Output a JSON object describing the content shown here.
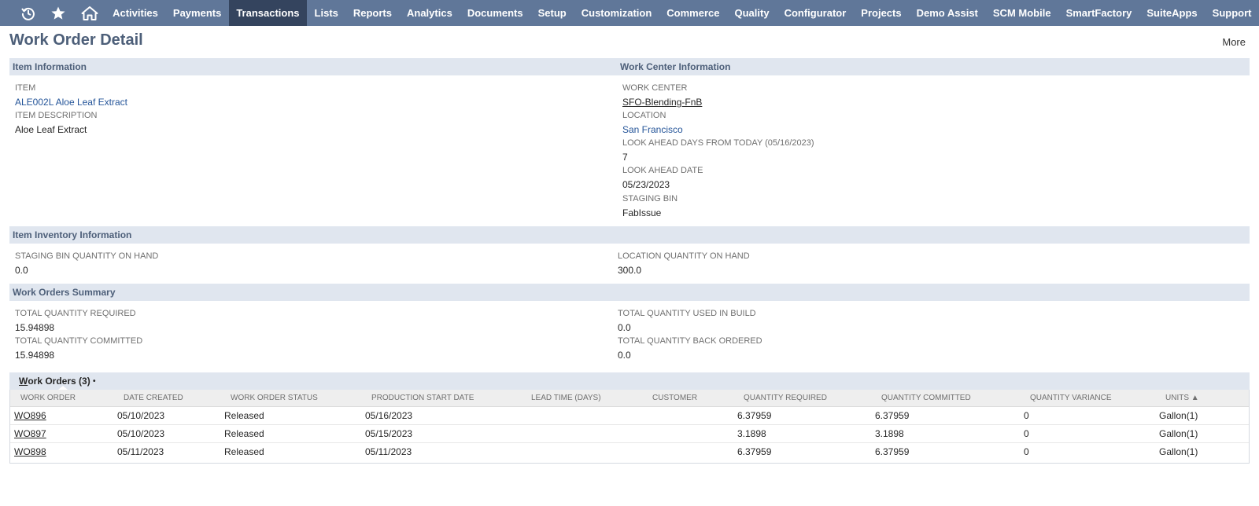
{
  "nav": {
    "icons": [
      "recent-history-icon",
      "favorites-star-icon",
      "home-icon"
    ],
    "items": [
      "Activities",
      "Payments",
      "Transactions",
      "Lists",
      "Reports",
      "Analytics",
      "Documents",
      "Setup",
      "Customization",
      "Commerce",
      "Quality",
      "Configurator",
      "Projects",
      "Demo Assist",
      "SCM Mobile",
      "SmartFactory",
      "SuiteApps",
      "Support"
    ],
    "active": "Transactions"
  },
  "page": {
    "title": "Work Order Detail",
    "more": "More"
  },
  "item_info": {
    "header": "Item Information",
    "item_label": "ITEM",
    "item_value": "ALE002L Aloe Leaf Extract",
    "desc_label": "ITEM DESCRIPTION",
    "desc_value": "Aloe Leaf Extract"
  },
  "work_center_info": {
    "header": "Work Center Information",
    "work_center_label": "WORK CENTER",
    "work_center_value": "SFO-Blending-FnB",
    "location_label": "LOCATION",
    "location_value": "San Francisco",
    "look_ahead_days_label": "LOOK AHEAD DAYS FROM TODAY (05/16/2023)",
    "look_ahead_days_value": "7",
    "look_ahead_date_label": "LOOK AHEAD DATE",
    "look_ahead_date_value": "05/23/2023",
    "staging_bin_label": "STAGING BIN",
    "staging_bin_value": "FabIssue"
  },
  "inventory_info": {
    "header": "Item Inventory Information",
    "staging_qty_label": "STAGING BIN QUANTITY ON HAND",
    "staging_qty_value": "0.0",
    "location_qty_label": "LOCATION QUANTITY ON HAND",
    "location_qty_value": "300.0"
  },
  "summary": {
    "header": "Work Orders Summary",
    "total_required_label": "TOTAL QUANTITY REQUIRED",
    "total_required_value": "15.94898",
    "total_committed_label": "TOTAL QUANTITY COMMITTED",
    "total_committed_value": "15.94898",
    "total_used_label": "TOTAL QUANTITY USED IN BUILD",
    "total_used_value": "0.0",
    "total_back_label": "TOTAL QUANTITY BACK ORDERED",
    "total_back_value": "0.0"
  },
  "work_orders": {
    "tab_first": "W",
    "tab_rest": "ork Orders (3)",
    "tab_dot": "•",
    "columns": [
      "WORK ORDER",
      "DATE CREATED",
      "WORK ORDER STATUS",
      "PRODUCTION START DATE",
      "LEAD TIME (DAYS)",
      "CUSTOMER",
      "QUANTITY REQUIRED",
      "QUANTITY COMMITTED",
      "QUANTITY VARIANCE",
      "UNITS ▲"
    ],
    "rows": [
      {
        "wo": "WO896",
        "date_created": "05/10/2023",
        "status": "Released",
        "start_date": "05/16/2023",
        "lead_time": "",
        "customer": "",
        "qty_required": "6.37959",
        "qty_committed": "6.37959",
        "qty_variance": "0",
        "units": "Gallon(1)"
      },
      {
        "wo": "WO897",
        "date_created": "05/10/2023",
        "status": "Released",
        "start_date": "05/15/2023",
        "lead_time": "",
        "customer": "",
        "qty_required": "3.1898",
        "qty_committed": "3.1898",
        "qty_variance": "0",
        "units": "Gallon(1)"
      },
      {
        "wo": "WO898",
        "date_created": "05/11/2023",
        "status": "Released",
        "start_date": "05/11/2023",
        "lead_time": "",
        "customer": "",
        "qty_required": "6.37959",
        "qty_committed": "6.37959",
        "qty_variance": "0",
        "units": "Gallon(1)"
      }
    ]
  }
}
